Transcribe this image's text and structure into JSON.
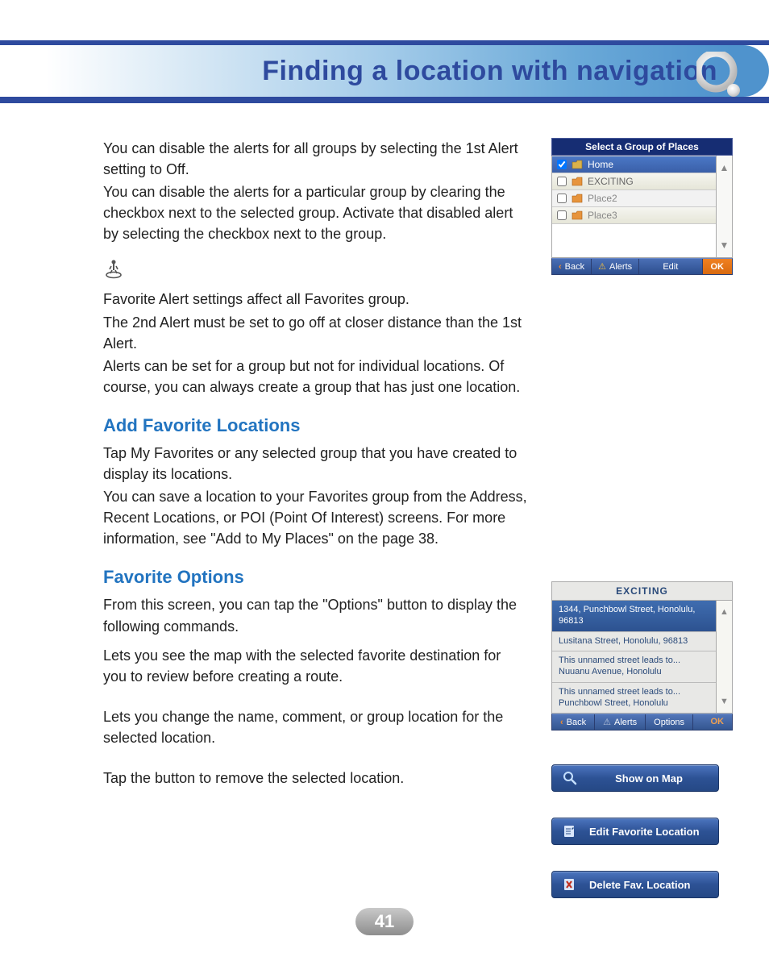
{
  "header": {
    "title": "Finding a location with navigation"
  },
  "main": {
    "p1": "You can disable the alerts for all groups by selecting the 1st Alert setting to Off.",
    "p2": "You can disable the alerts for a particular group by clearing the checkbox next to the selected group. Activate that disabled alert by selecting the checkbox next to the group.",
    "note1": "Favorite Alert settings affect all Favorites group.",
    "note2": "The 2nd Alert must be set to go off at closer distance than the 1st Alert.",
    "note3": "Alerts can be set for a group but not for individual locations. Of course, you can always create a group that has just one location.",
    "h_add": "Add Favorite Locations",
    "add_p1": "Tap My Favorites or any selected group that you have created to display its locations.",
    "add_p2": "You can save a location to your Favorites group from the Address, Recent Locations, or POI (Point Of Interest) screens. For more information, see \"Add to My Places\" on the page 38.",
    "h_opt": "Favorite Options",
    "opt_p1": "From this screen, you can tap the \"Options\" button to display the following commands.",
    "opt_p2": "Lets you see the map with the selected favorite destination for you to review before creating a route.",
    "opt_p3": "Lets you change the name, comment, or group location for the selected location.",
    "opt_p4": "Tap the button to remove the selected location."
  },
  "groups_screen": {
    "title": "Select a Group of Places",
    "items": [
      "Home",
      "EXCITING",
      "Place2",
      "Place3"
    ],
    "buttons": {
      "back": "Back",
      "alerts": "Alerts",
      "edit": "Edit",
      "ok": "OK"
    }
  },
  "loc_screen": {
    "title": "EXCITING",
    "items": [
      "1344, Punchbowl Street, Honolulu, 96813",
      "Lusitana Street, Honolulu, 96813",
      "This unnamed street leads to... Nuuanu Avenue, Honolulu",
      "This unnamed street leads to... Punchbowl Street, Honolulu"
    ],
    "buttons": {
      "back": "Back",
      "alerts": "Alerts",
      "options": "Options",
      "ok": "OK"
    }
  },
  "option_buttons": {
    "show": "Show on Map",
    "edit": "Edit Favorite Location",
    "del": "Delete Fav. Location"
  },
  "page_number": "41"
}
